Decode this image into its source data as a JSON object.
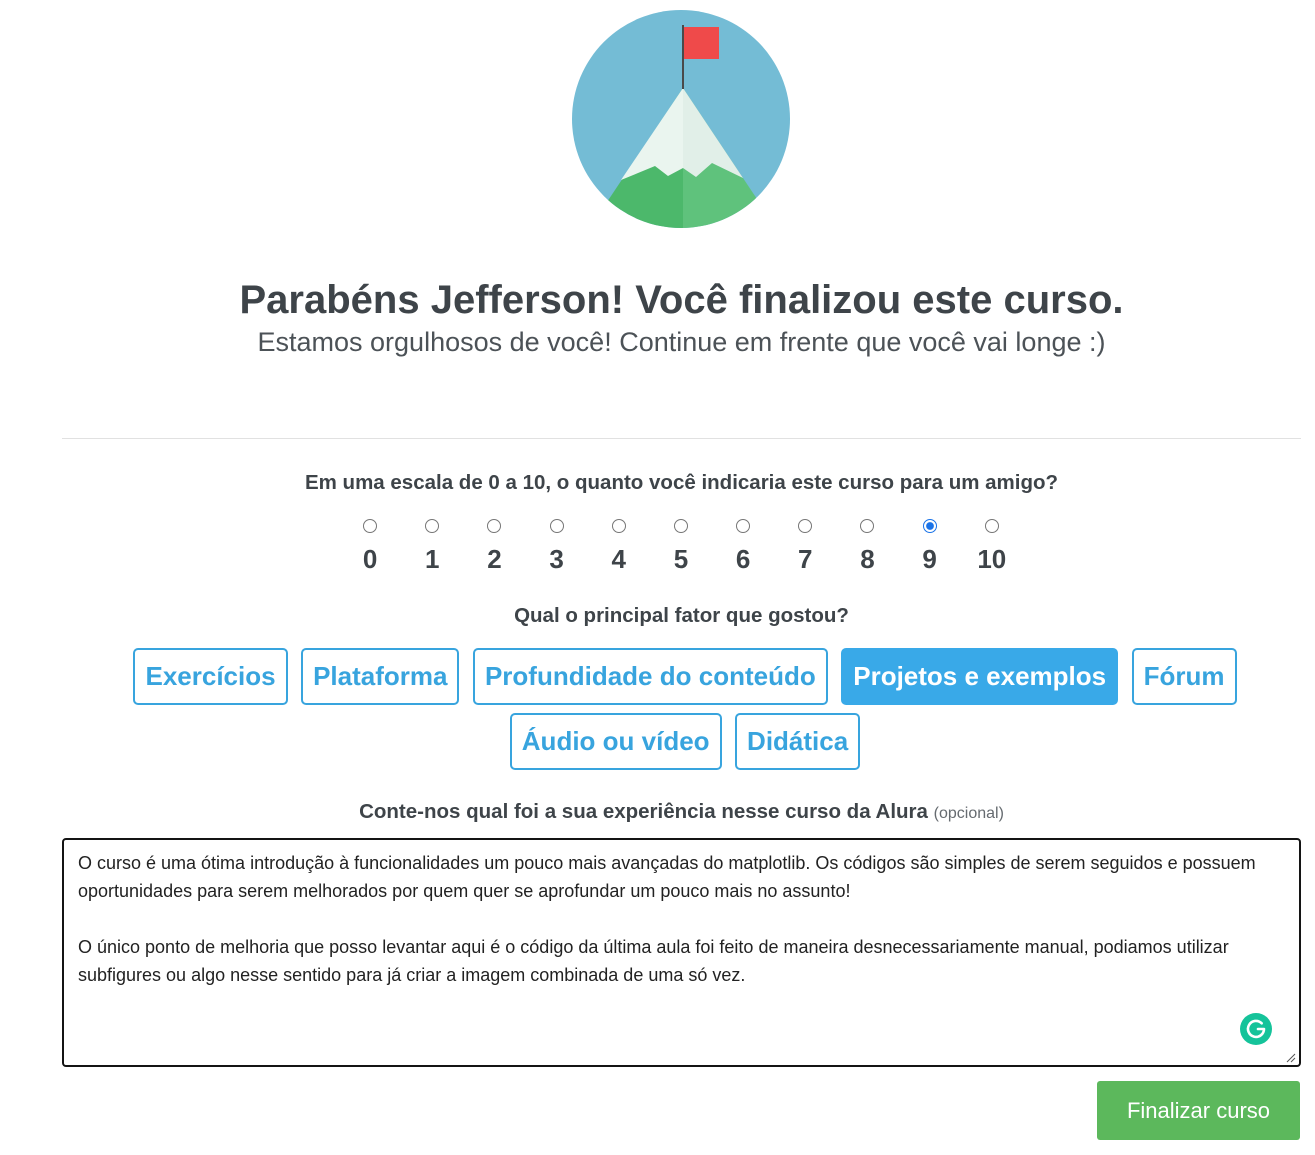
{
  "header": {
    "title": "Parabéns Jefferson! Você finalizou este curso.",
    "subtitle": "Estamos orgulhosos de você! Continue em frente que você vai longe :)"
  },
  "icons": {
    "illustration": "mountain-flag-icon",
    "grammarly": "grammarly-icon",
    "resize": "resize-handle-icon"
  },
  "recommendation": {
    "question": "Em uma escala de 0 a 10, o quanto você indicaria este curso para um amigo?",
    "options": [
      "0",
      "1",
      "2",
      "3",
      "4",
      "5",
      "6",
      "7",
      "8",
      "9",
      "10"
    ],
    "selected": 9
  },
  "factors": {
    "question": "Qual o principal fator que gostou?",
    "options": [
      "Exercícios",
      "Plataforma",
      "Profundidade do conteúdo",
      "Projetos e exemplos",
      "Fórum",
      "Áudio ou vídeo",
      "Didática"
    ],
    "selected_index": 3
  },
  "feedback": {
    "label": "Conte-nos qual foi a sua experiência nesse curso da Alura",
    "optional_label": "(opcional)",
    "value": "O curso é uma ótima introdução à funcionalidades um pouco mais avançadas do matplotlib. Os códigos são simples de serem seguidos e possuem oportunidades para serem melhorados por quem quer se aprofundar um pouco mais no assunto!\n\nO único ponto de melhoria que posso levantar aqui é o código da última aula foi feito de maneira desnecessariamente manual, podiamos utilizar subfigures ou algo nesse sentido para já criar a imagem combinada de uma só vez."
  },
  "submit": {
    "label": "Finalizar curso"
  },
  "colors": {
    "accent": "#38a4de",
    "accent_fill": "#39a9e8",
    "success": "#5cb85c",
    "text": "#3e4449",
    "sky": "#74bcd5",
    "flag": "#ef4a4a",
    "radio_checked": "#1a73e8"
  }
}
